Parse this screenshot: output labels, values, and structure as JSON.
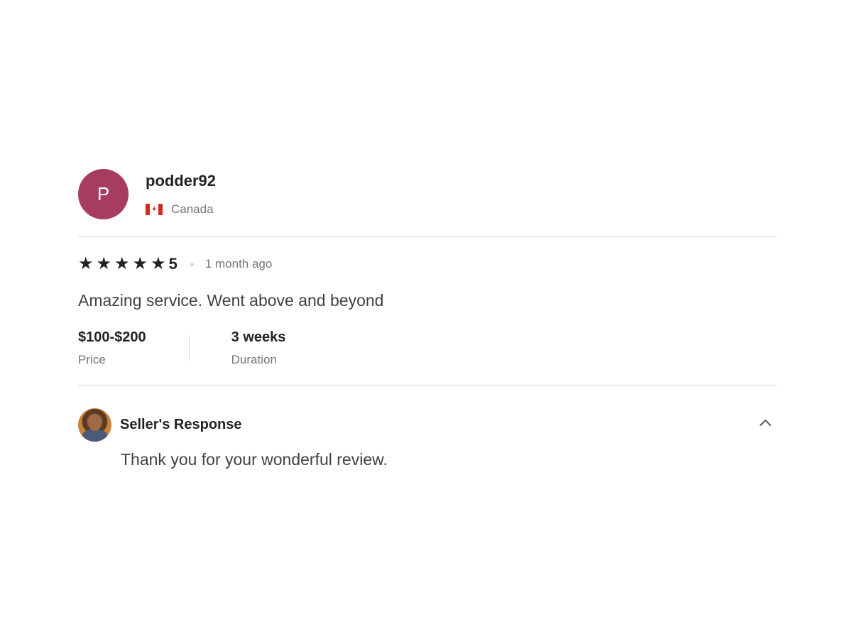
{
  "reviewer": {
    "avatar_letter": "P",
    "avatar_color": "#a63d60",
    "username": "podder92",
    "country": "Canada",
    "flag_colors": {
      "red": "#d52b1e",
      "white": "#ffffff"
    }
  },
  "review": {
    "rating": 5,
    "rating_label": "5",
    "stars": [
      "★",
      "★",
      "★",
      "★",
      "★"
    ],
    "time_ago": "1 month ago",
    "text": "Amazing service. Went above and beyond",
    "price": {
      "value": "$100-$200",
      "label": "Price"
    },
    "duration": {
      "value": "3 weeks",
      "label": "Duration"
    }
  },
  "seller_response": {
    "title": "Seller's Response",
    "text": "Thank you for your wonderful review.",
    "toggle_icon": "chevron-up-icon"
  }
}
